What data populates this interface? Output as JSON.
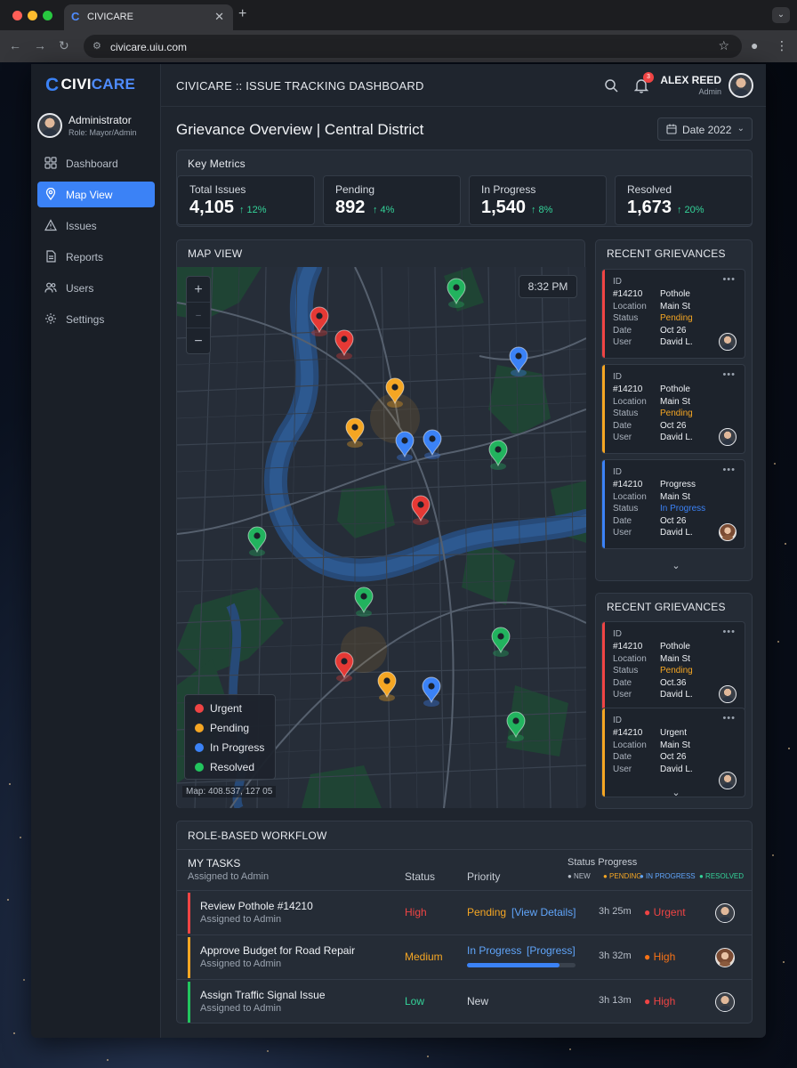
{
  "browser": {
    "tab_title": "CIVICARE",
    "tab_logo": "C",
    "url": "civicare.uiu.com"
  },
  "brand": {
    "mark": "C",
    "part1": "CIVI",
    "part2": "CARE"
  },
  "profile": {
    "name": "Administrator",
    "role": "Role: Mayor/Admin"
  },
  "sidebar": {
    "items": [
      {
        "label": "Dashboard",
        "icon": "grid-icon"
      },
      {
        "label": "Map View",
        "icon": "map-pin-icon",
        "active": true
      },
      {
        "label": "Issues",
        "icon": "warning-icon"
      },
      {
        "label": "Reports",
        "icon": "document-icon"
      },
      {
        "label": "Users",
        "icon": "users-icon"
      },
      {
        "label": "Settings",
        "icon": "gear-icon"
      }
    ]
  },
  "header": {
    "title": "CIVICARE :: ISSUE TRACKING DASHBOARD",
    "notification_count": "3",
    "user_name": "ALEX REED",
    "user_role": "Admin"
  },
  "page": {
    "title": "Grievance Overview | Central District",
    "date_filter": "Date 2022",
    "date_chevron": "⌄"
  },
  "metrics": {
    "title": "Key Metrics",
    "items": [
      {
        "label": "Total Issues",
        "value": "4,105",
        "delta": "↑ 12%"
      },
      {
        "label": "Pending",
        "value": "892",
        "delta": "↑ 4%"
      },
      {
        "label": "In Progress",
        "value": "1,540",
        "delta": "↑ 8%"
      },
      {
        "label": "Resolved",
        "value": "1,673",
        "delta": "↑ 20%"
      }
    ]
  },
  "map": {
    "title": "MAP VIEW",
    "time": "8:32 PM",
    "zoom_in": "+",
    "zoom_mid": "–",
    "zoom_out": "−",
    "coords": "Map: 408.537, 127 05",
    "legend": [
      {
        "label": "Urgent",
        "color": "#ef4444"
      },
      {
        "label": "Pending",
        "color": "#f5a623"
      },
      {
        "label": "In Progress",
        "color": "#3b82f6"
      },
      {
        "label": "Resolved",
        "color": "#22c55e"
      }
    ],
    "status_colors": {
      "urgent": "#e53935",
      "pending": "#f5a623",
      "in_progress": "#3b82f6",
      "resolved": "#22b35e"
    }
  },
  "recent1": {
    "title": "RECENT GRIEVANCES",
    "more": "⌄",
    "dots": "•••",
    "cards": [
      {
        "id_label": "ID",
        "id": "#14210",
        "type": "Pothole",
        "loc_label": "Location",
        "location": "Main St",
        "status_label": "Status",
        "status": "Pending",
        "date_label": "Date",
        "date": "Oct 26",
        "user_label": "User",
        "user": "David L.",
        "stripe": "#ef4444",
        "status_color": "#f5a623"
      },
      {
        "id_label": "ID",
        "id": "#14210",
        "type": "Pothole",
        "loc_label": "Location",
        "location": "Main St",
        "status_label": "Status",
        "status": "Pending",
        "date_label": "Date",
        "date": "Oct 26",
        "user_label": "User",
        "user": "David L.",
        "stripe": "#f5a623",
        "status_color": "#f5a623"
      },
      {
        "id_label": "ID",
        "id": "#14210",
        "type": "Progress",
        "loc_label": "Location",
        "location": "Main St",
        "status_label": "Status",
        "status": "In Progress",
        "date_label": "Date",
        "date": "Oct 26",
        "user_label": "User",
        "user": "David L.",
        "stripe": "#3b82f6",
        "status_color": "#3b82f6"
      }
    ]
  },
  "recent2": {
    "title": "RECENT GRIEVANCES",
    "more": "⌄",
    "dots": "•••",
    "cards": [
      {
        "id_label": "ID",
        "id": "#14210",
        "type": "Pothole",
        "loc_label": "Location",
        "location": "Main St",
        "status_label": "Status",
        "status": "Pending",
        "date_label": "Date",
        "date": "Oct.36",
        "user_label": "User",
        "user": "David L.",
        "stripe": "#ef4444",
        "status_color": "#f5a623"
      },
      {
        "id_label": "ID",
        "id": "#14210",
        "type": "Urgent",
        "loc_label": "Location",
        "location": "Main St",
        "date_label": "Date",
        "date": "Oct 26",
        "user_label": "User",
        "user": "David L.",
        "stripe": "#f5a623"
      }
    ]
  },
  "workflow": {
    "title": "ROLE-BASED WORKFLOW",
    "tasks_title": "MY TASKS",
    "tasks_sub": "Assigned to Admin",
    "col_status": "Status",
    "col_priority": "Priority",
    "col_progress": "Status Progress",
    "progress_legend": [
      {
        "label": "● NEW",
        "color": "#b7bec8"
      },
      {
        "label": "● PENDING",
        "color": "#f5a623"
      },
      {
        "label": "● IN PROGRESS",
        "color": "#60a5fa"
      },
      {
        "label": "● RESOLVED",
        "color": "#34d399"
      }
    ],
    "rows": [
      {
        "title": "Review Pothole #14210",
        "sub": "Assigned to Admin",
        "level": "High",
        "level_color": "#ef4444",
        "state": "Pending",
        "state_color": "#f5a623",
        "link": "[View Details]",
        "time": "3h 25m",
        "priority": "● Urgent",
        "priority_color": "#ef4444",
        "stripe": "#ef4444"
      },
      {
        "title": "Approve Budget for Road Repair",
        "sub": "Assigned to Admin",
        "level": "Medium",
        "level_color": "#f5a623",
        "state": "In Progress",
        "state_color": "#60a5fa",
        "link": "[Progress]",
        "progress": 0.85,
        "time": "3h 32m",
        "priority": "● High",
        "priority_color": "#f97316",
        "stripe": "#f5a623"
      },
      {
        "title": "Assign Traffic Signal Issue",
        "sub": "Assigned to Admin",
        "level": "Low",
        "level_color": "#34d399",
        "state": "New",
        "state_color": "#d5dae1",
        "time": "3h 13m",
        "priority": "● High",
        "priority_color": "#ef4444",
        "stripe": "#22c55e"
      }
    ]
  }
}
